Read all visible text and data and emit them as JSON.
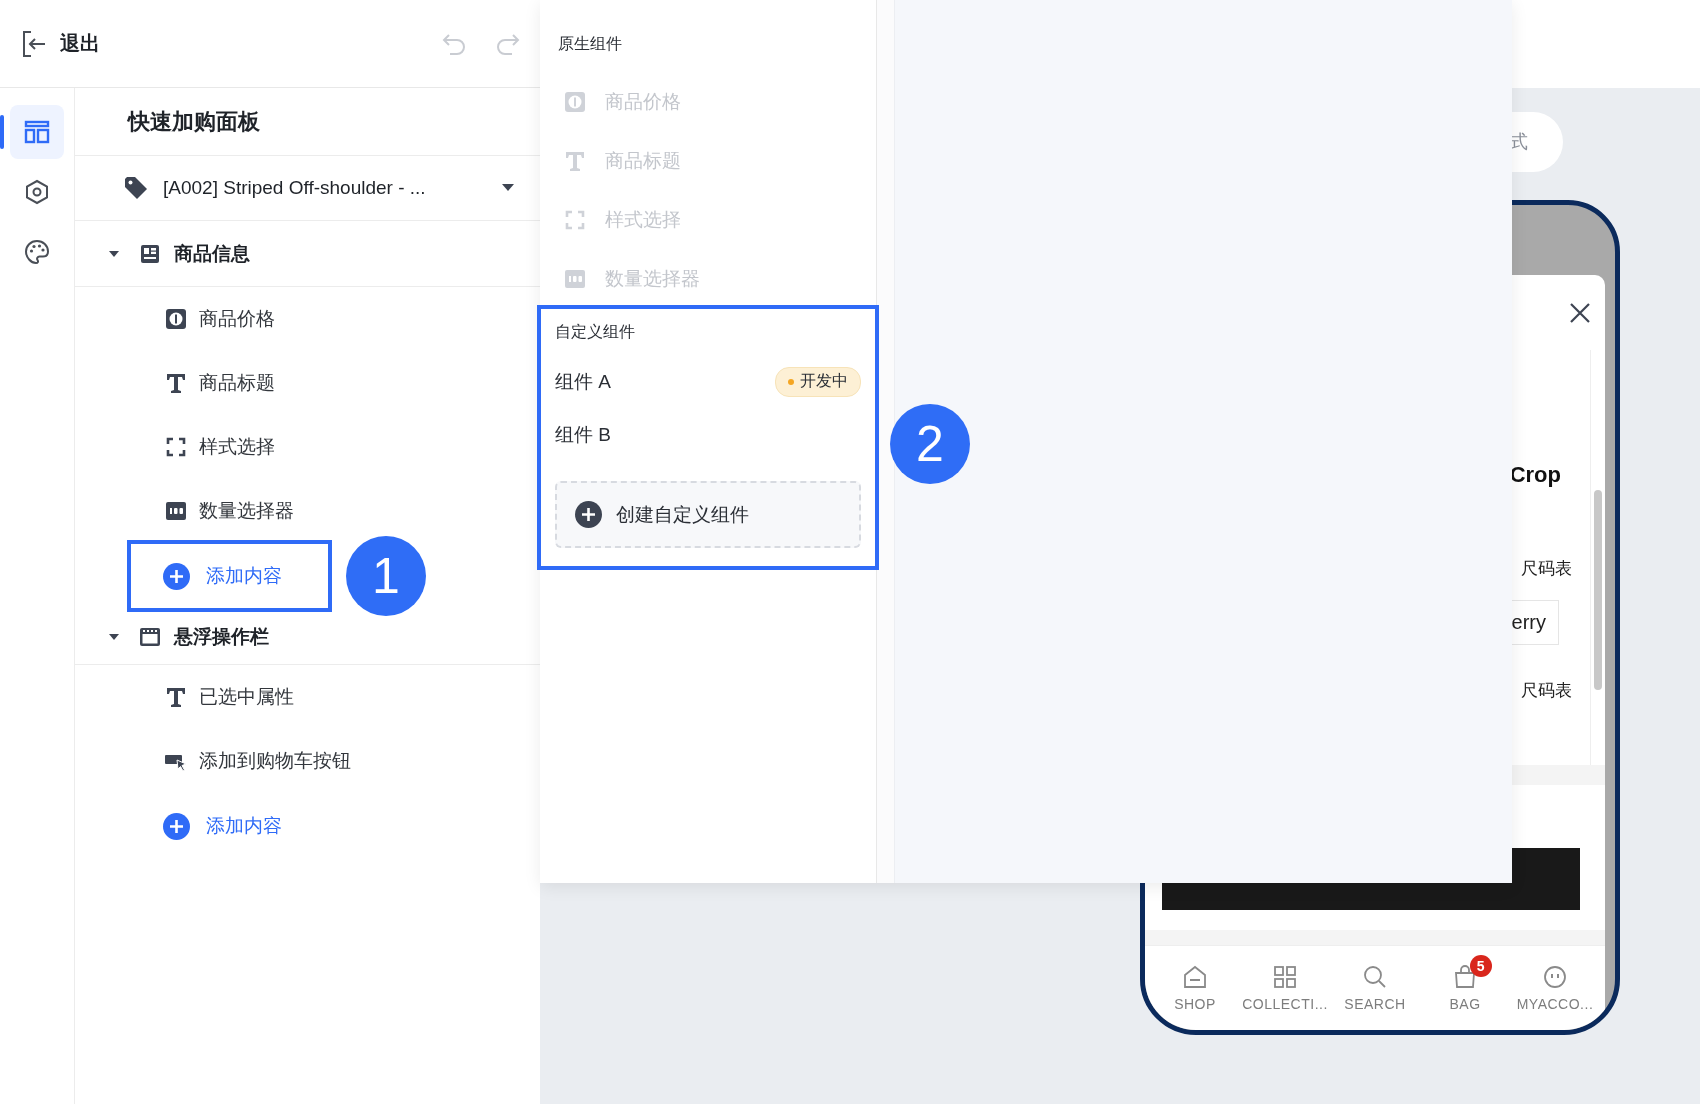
{
  "top_bar": {
    "exit_label": "退出"
  },
  "rail": [
    {
      "kind": "layout",
      "selected": true
    },
    {
      "kind": "settings",
      "selected": false
    },
    {
      "kind": "theme",
      "selected": false
    }
  ],
  "panel": {
    "title": "快速加购面板",
    "product": "[A002] Striped Off-shoulder - ...",
    "groups": [
      {
        "label": "商品信息",
        "kind": "info",
        "expanded": true,
        "children": [
          {
            "label": "商品价格",
            "kind": "price"
          },
          {
            "label": "商品标题",
            "kind": "text"
          },
          {
            "label": "样式选择",
            "kind": "variant"
          },
          {
            "label": "数量选择器",
            "kind": "quantity"
          }
        ],
        "add": {
          "label": "添加内容",
          "highlighted": true,
          "callout": "1"
        }
      },
      {
        "label": "悬浮操作栏",
        "kind": "bar",
        "expanded": true,
        "children": [
          {
            "label": "已选中属性",
            "kind": "text"
          },
          {
            "label": "添加到购物车按钮",
            "kind": "button"
          }
        ],
        "add": {
          "label": "添加内容",
          "highlighted": false
        }
      }
    ]
  },
  "popup": {
    "native": {
      "title": "原生组件",
      "items": [
        {
          "label": "商品价格",
          "kind": "price",
          "disabled": true
        },
        {
          "label": "商品标题",
          "kind": "text",
          "disabled": true
        },
        {
          "label": "样式选择",
          "kind": "variant",
          "disabled": true
        },
        {
          "label": "数量选择器",
          "kind": "quantity",
          "disabled": true
        }
      ]
    },
    "custom": {
      "title": "自定义组件",
      "highlighted": true,
      "callout": "2",
      "items": [
        {
          "label": "组件 A",
          "status": "开发中"
        },
        {
          "label": "组件 B"
        }
      ],
      "create_label": "创建自定义组件"
    }
  },
  "preview": {
    "pill": "式",
    "sheet": [
      {
        "kind": "title",
        "text": "Crop"
      },
      {
        "kind": "link",
        "text": "尺码表"
      },
      {
        "kind": "option",
        "text": "erry"
      },
      {
        "kind": "link",
        "text": "尺码表"
      }
    ],
    "nav": [
      {
        "kind": "shop",
        "label": "SHOP"
      },
      {
        "kind": "collections",
        "label": "COLLECTI..."
      },
      {
        "kind": "search",
        "label": "SEARCH"
      },
      {
        "kind": "bag",
        "label": "BAG",
        "badge": "5"
      },
      {
        "kind": "account",
        "label": "MYACCO..."
      }
    ]
  }
}
